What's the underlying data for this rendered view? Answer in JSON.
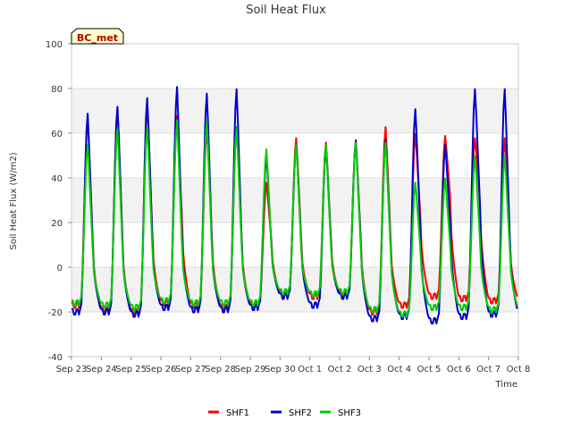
{
  "chart_data": {
    "type": "line",
    "title": "Soil Heat Flux",
    "xlabel": "Time",
    "ylabel": "Soil Heat Flux (W/m2)",
    "badge": "BC_met",
    "ylim": [
      -40,
      100
    ],
    "yticks": [
      -40,
      -20,
      0,
      20,
      40,
      60,
      80,
      100
    ],
    "xlim": [
      0,
      15
    ],
    "xticks": [
      "Sep 23",
      "Sep 24",
      "Sep 25",
      "Sep 26",
      "Sep 27",
      "Sep 28",
      "Sep 29",
      "Sep 30",
      "Oct 1",
      "Oct 2",
      "Oct 3",
      "Oct 4",
      "Oct 5",
      "Oct 6",
      "Oct 7",
      "Oct 8"
    ],
    "grid": "horizontal bands",
    "legend_position": "bottom-center",
    "series": [
      {
        "name": "SHF1",
        "color": "#ff0000",
        "daily": [
          {
            "min": -17,
            "max": 67,
            "evening": 10
          },
          {
            "min": -19,
            "max": 72,
            "evening": 10
          },
          {
            "min": -20,
            "max": 73,
            "evening": 13
          },
          {
            "min": -16,
            "max": 68,
            "evening": 18
          },
          {
            "min": -17,
            "max": 62,
            "evening": 12
          },
          {
            "min": -18,
            "max": 63,
            "evening": 10
          },
          {
            "min": -17,
            "max": 38,
            "evening": 10
          },
          {
            "min": -12,
            "max": 58,
            "evening": 10
          },
          {
            "min": -13,
            "max": 56,
            "evening": 10
          },
          {
            "min": -12,
            "max": 57,
            "evening": 10
          },
          {
            "min": -20,
            "max": 63,
            "evening": 10
          },
          {
            "min": -17,
            "max": 60,
            "evening": 20
          },
          {
            "min": -13,
            "max": 59,
            "evening": 30
          },
          {
            "min": -14,
            "max": 58,
            "evening": 28
          },
          {
            "min": -15,
            "max": 58,
            "evening": 10
          }
        ]
      },
      {
        "name": "SHF2",
        "color": "#0000cc",
        "daily": [
          {
            "min": -20,
            "max": 69,
            "evening": 8
          },
          {
            "min": -20,
            "max": 72,
            "evening": 8
          },
          {
            "min": -21,
            "max": 76,
            "evening": 10
          },
          {
            "min": -18,
            "max": 81,
            "evening": 10
          },
          {
            "min": -19,
            "max": 78,
            "evening": 8
          },
          {
            "min": -19,
            "max": 80,
            "evening": 8
          },
          {
            "min": -18,
            "max": 50,
            "evening": 8
          },
          {
            "min": -13,
            "max": 55,
            "evening": 8
          },
          {
            "min": -17,
            "max": 54,
            "evening": 8
          },
          {
            "min": -13,
            "max": 57,
            "evening": 8
          },
          {
            "min": -23,
            "max": 57,
            "evening": 8
          },
          {
            "min": -22,
            "max": 71,
            "evening": 12
          },
          {
            "min": -24,
            "max": 55,
            "evening": 18
          },
          {
            "min": -22,
            "max": 80,
            "evening": 25
          },
          {
            "min": -21,
            "max": 80,
            "evening": 10
          }
        ]
      },
      {
        "name": "SHF3",
        "color": "#00cc00",
        "daily": [
          {
            "min": -16,
            "max": 55,
            "evening": 6
          },
          {
            "min": -17,
            "max": 62,
            "evening": 6
          },
          {
            "min": -18,
            "max": 63,
            "evening": 6
          },
          {
            "min": -15,
            "max": 66,
            "evening": 6
          },
          {
            "min": -16,
            "max": 65,
            "evening": 6
          },
          {
            "min": -16,
            "max": 63,
            "evening": 6
          },
          {
            "min": -16,
            "max": 53,
            "evening": 6
          },
          {
            "min": -11,
            "max": 55,
            "evening": 6
          },
          {
            "min": -12,
            "max": 55,
            "evening": 6
          },
          {
            "min": -11,
            "max": 56,
            "evening": 6
          },
          {
            "min": -19,
            "max": 56,
            "evening": 6
          },
          {
            "min": -21,
            "max": 38,
            "evening": 6
          },
          {
            "min": -18,
            "max": 40,
            "evening": 8
          },
          {
            "min": -18,
            "max": 50,
            "evening": 10
          },
          {
            "min": -19,
            "max": 50,
            "evening": 6
          }
        ]
      }
    ]
  }
}
